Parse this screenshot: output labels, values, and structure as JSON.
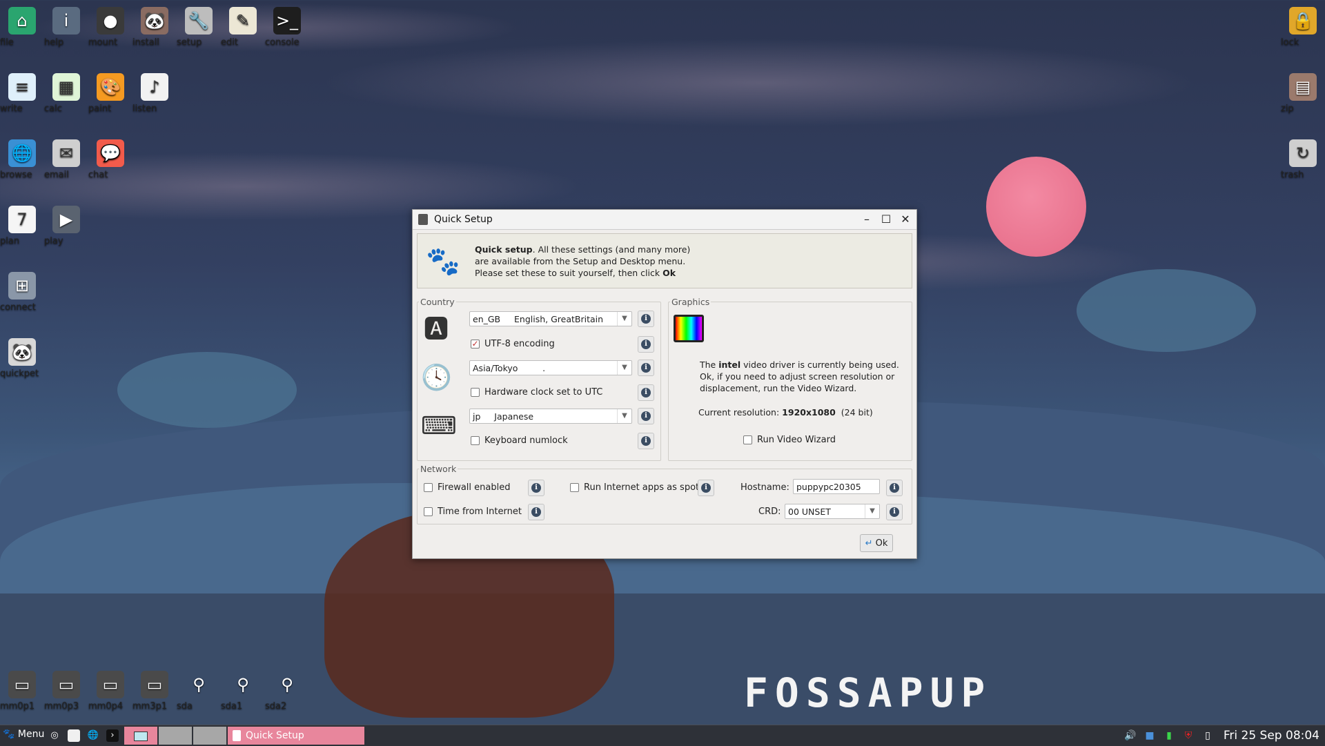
{
  "desktop": {
    "icons_left": [
      {
        "label": "file",
        "icon": "house-icon",
        "color": "#2aa56f"
      },
      {
        "label": "help",
        "icon": "info-icon",
        "color": "#5a6b80"
      },
      {
        "label": "mount",
        "icon": "disk-icon",
        "color": "#3a3a3a"
      },
      {
        "label": "install",
        "icon": "puppy-box-icon",
        "color": "#8a6c62"
      },
      {
        "label": "setup",
        "icon": "wrench-icon",
        "color": "#bdbdbd"
      },
      {
        "label": "edit",
        "icon": "notepad-icon",
        "color": "#ece7d5"
      },
      {
        "label": "console",
        "icon": "terminal-icon",
        "color": "#1e1e1e"
      },
      {
        "label": "write",
        "icon": "document-icon",
        "color": "#dff0fb"
      },
      {
        "label": "calc",
        "icon": "spreadsheet-icon",
        "color": "#dff5d7"
      },
      {
        "label": "paint",
        "icon": "palette-icon",
        "color": "#f59a21"
      },
      {
        "label": "listen",
        "icon": "music-note-icon",
        "color": "#f2f2f2"
      },
      {
        "label": "browse",
        "icon": "globe-icon",
        "color": "#3a90d4"
      },
      {
        "label": "email",
        "icon": "envelope-icon",
        "color": "#cfcfcf"
      },
      {
        "label": "chat",
        "icon": "chat-bubble-icon",
        "color": "#f25b4b"
      },
      {
        "label": "plan",
        "icon": "calendar-icon",
        "color": "#f5f5f5"
      },
      {
        "label": "play",
        "icon": "video-play-icon",
        "color": "#5a6370"
      },
      {
        "label": "connect",
        "icon": "network-icon",
        "color": "#8a97a8"
      },
      {
        "label": "quickpet",
        "icon": "panda-icon",
        "color": "#d8d8d8"
      }
    ],
    "icons_right": [
      {
        "label": "lock",
        "icon": "lock-icon",
        "color": "#e1a72a"
      },
      {
        "label": "zip",
        "icon": "archive-icon",
        "color": "#9b7a6c"
      },
      {
        "label": "trash",
        "icon": "trash-icon",
        "color": "#cfcfcf"
      }
    ],
    "drives": [
      {
        "label": "mm0p1",
        "icon": "sd-card-icon"
      },
      {
        "label": "mm0p3",
        "icon": "sd-card-icon"
      },
      {
        "label": "mm0p4",
        "icon": "sd-card-icon"
      },
      {
        "label": "mm3p1",
        "icon": "sd-card-icon"
      },
      {
        "label": "sda",
        "icon": "usb-drive-icon"
      },
      {
        "label": "sda1",
        "icon": "usb-drive-icon"
      },
      {
        "label": "sda2",
        "icon": "usb-drive-icon"
      }
    ],
    "brand_text": "FOSSAPUP"
  },
  "dialog": {
    "title": "Quick Setup",
    "intro_bold": "Quick setup",
    "intro_line1": ". All these settings (and many more)",
    "intro_line2": "are available from the Setup and Desktop menu.",
    "intro_line3": "Please set these to suit yourself, then click ",
    "intro_ok": "Ok",
    "country": {
      "legend": "Country",
      "locale_code": "en_GB",
      "locale_name": "English, GreatBritain",
      "utf8_label": "UTF-8 encoding",
      "utf8_checked": true,
      "timezone": "Asia/Tokyo",
      "timezone_suffix": ".",
      "hwclock_label": "Hardware clock set to UTC",
      "keyboard_code": "jp",
      "keyboard_name": "Japanese",
      "numlock_label": "Keyboard numlock"
    },
    "graphics": {
      "legend": "Graphics",
      "line1_pre": "The ",
      "line1_bold": "intel",
      "line1_post": " video driver is currently being used.",
      "line2": "Ok, if you need to adjust screen resolution or",
      "line3": "displacement, run the Video Wizard.",
      "res_label": "Current resolution: ",
      "res_value": "1920x1080",
      "res_depth": "(24 bit)",
      "wizard_label": "Run Video Wizard"
    },
    "network": {
      "legend": "Network",
      "firewall_label": "Firewall enabled",
      "spot_label": "Run Internet apps as spot",
      "hostname_label": "Hostname:",
      "hostname_value": "puppypc20305",
      "time_label": "Time from Internet",
      "crd_label": "CRD:",
      "crd_value": "00 UNSET"
    },
    "ok_label": "Ok"
  },
  "taskbar": {
    "menu_label": "Menu",
    "task_label": "Quick Setup",
    "clock": "Fri 25 Sep 08:04"
  }
}
